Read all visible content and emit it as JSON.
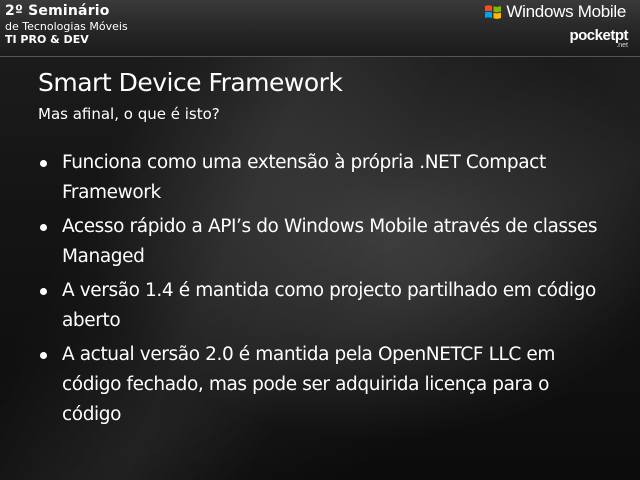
{
  "header": {
    "event_title": "2º Seminário",
    "event_subtitle": "de Tecnologias Móveis",
    "event_tag": "TI PRO & DEV",
    "windows_mobile_logo_text": "Windows Mobile",
    "pocketpt_logo_text": "pocketpt",
    "pocketpt_logo_suffix": ".net",
    "flag_colors": {
      "red": "#f25022",
      "green": "#7fba00",
      "blue": "#00a4ef",
      "yellow": "#ffb900"
    }
  },
  "slide": {
    "title": "Smart Device Framework",
    "subtitle": "Mas afinal, o que é isto?",
    "bullets": [
      {
        "text": "Funciona como uma extensão à própria .NET Compact Framework"
      },
      {
        "text": "Acesso rápido a API’s do Windows Mobile através de classes Managed"
      },
      {
        "text": "A versão 1.4 é mantida como projecto partilhado em código aberto"
      },
      {
        "text": "A actual versão 2.0 é mantida pela OpenNETCF LLC em código fechado, mas pode ser adquirida licença para o código"
      }
    ]
  }
}
